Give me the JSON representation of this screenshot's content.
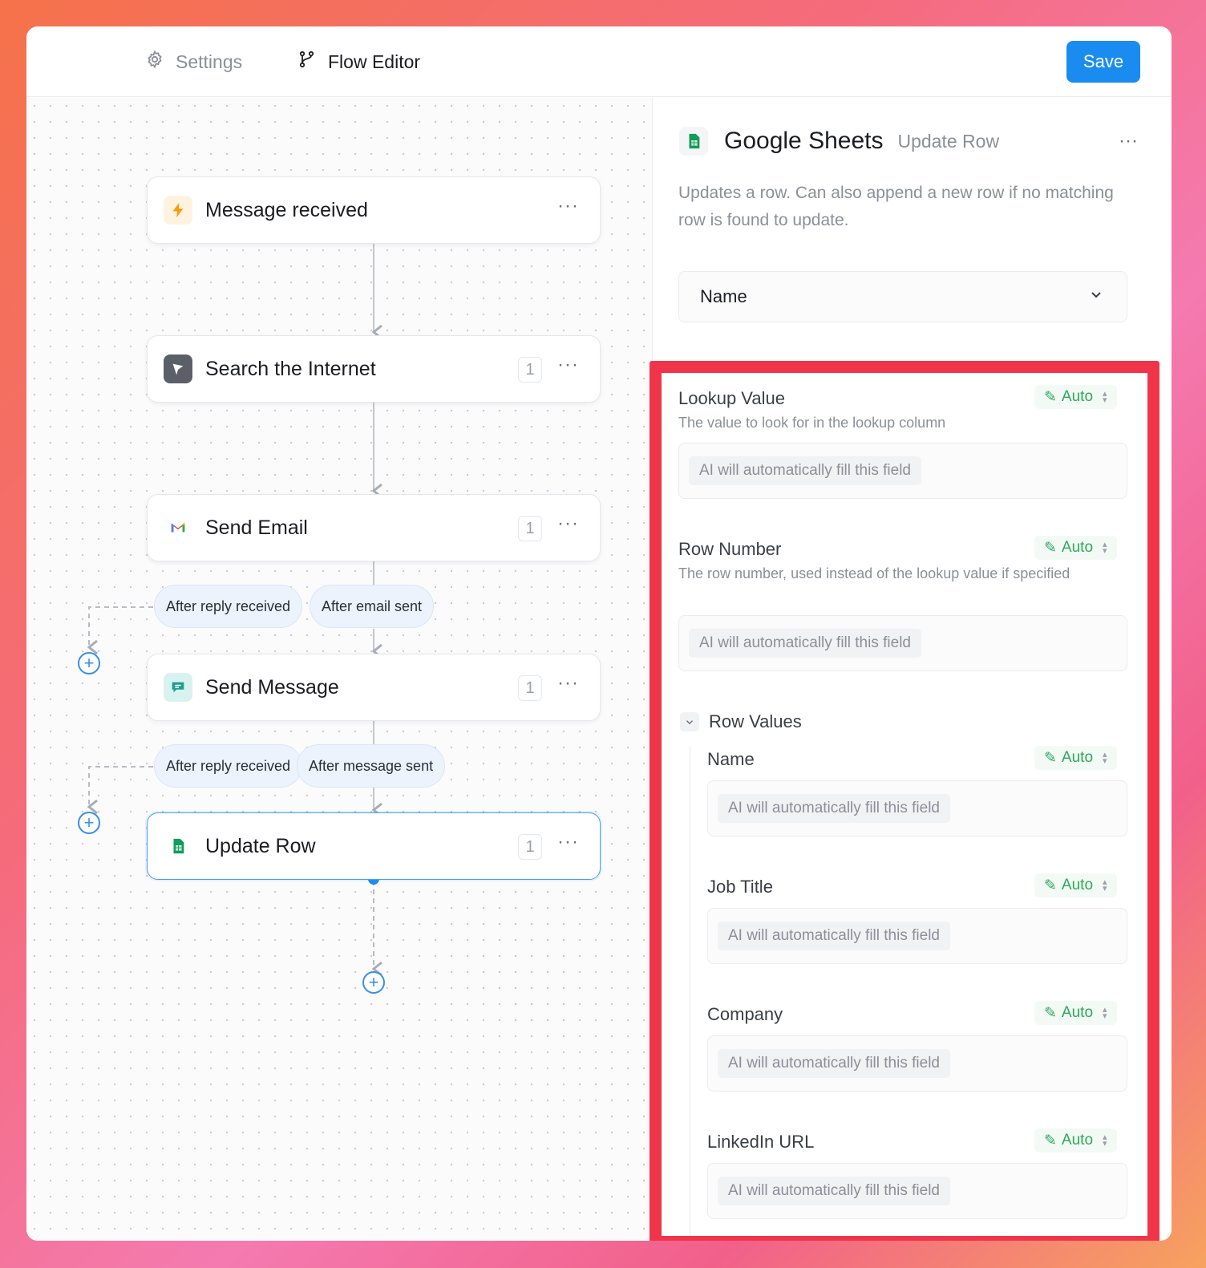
{
  "header": {
    "tabs": [
      {
        "label": "Settings",
        "icon": "gear-icon"
      },
      {
        "label": "Flow Editor",
        "icon": "flow-branch-icon"
      }
    ],
    "save_label": "Save"
  },
  "colors": {
    "accent": "#1a8cf0",
    "auto_green": "#2fa85a",
    "highlight_red": "#f0354a"
  },
  "flow": {
    "nodes": [
      {
        "title": "Message received",
        "icon": "lightning-icon",
        "count": ""
      },
      {
        "title": "Search the Internet",
        "icon": "search-internet-icon",
        "count": "1"
      },
      {
        "title": "Send Email",
        "icon": "gmail-icon",
        "count": "1"
      },
      {
        "title": "Send Message",
        "icon": "chat-message-icon",
        "count": "1"
      },
      {
        "title": "Update Row",
        "icon": "google-sheets-icon",
        "count": "1",
        "selected": true
      }
    ],
    "email_edges": [
      "After reply received",
      "After email sent"
    ],
    "message_edges": [
      "After reply received",
      "After message sent"
    ]
  },
  "panel": {
    "title": "Google Sheets",
    "subtitle": "Update Row",
    "description": "Updates a row. Can also append a new row if no matching row is found to update.",
    "select_value": "Name",
    "auto_label": "Auto",
    "placeholder": "AI will automatically fill this field",
    "lookup": {
      "label": "Lookup Value",
      "help": "The value to look for in the lookup column"
    },
    "row_number": {
      "label": "Row Number",
      "help": "The row number, used instead of the lookup value if specified"
    },
    "row_values": {
      "label": "Row Values",
      "fields": [
        "Name",
        "Job Title",
        "Company",
        "LinkedIn URL"
      ]
    }
  }
}
